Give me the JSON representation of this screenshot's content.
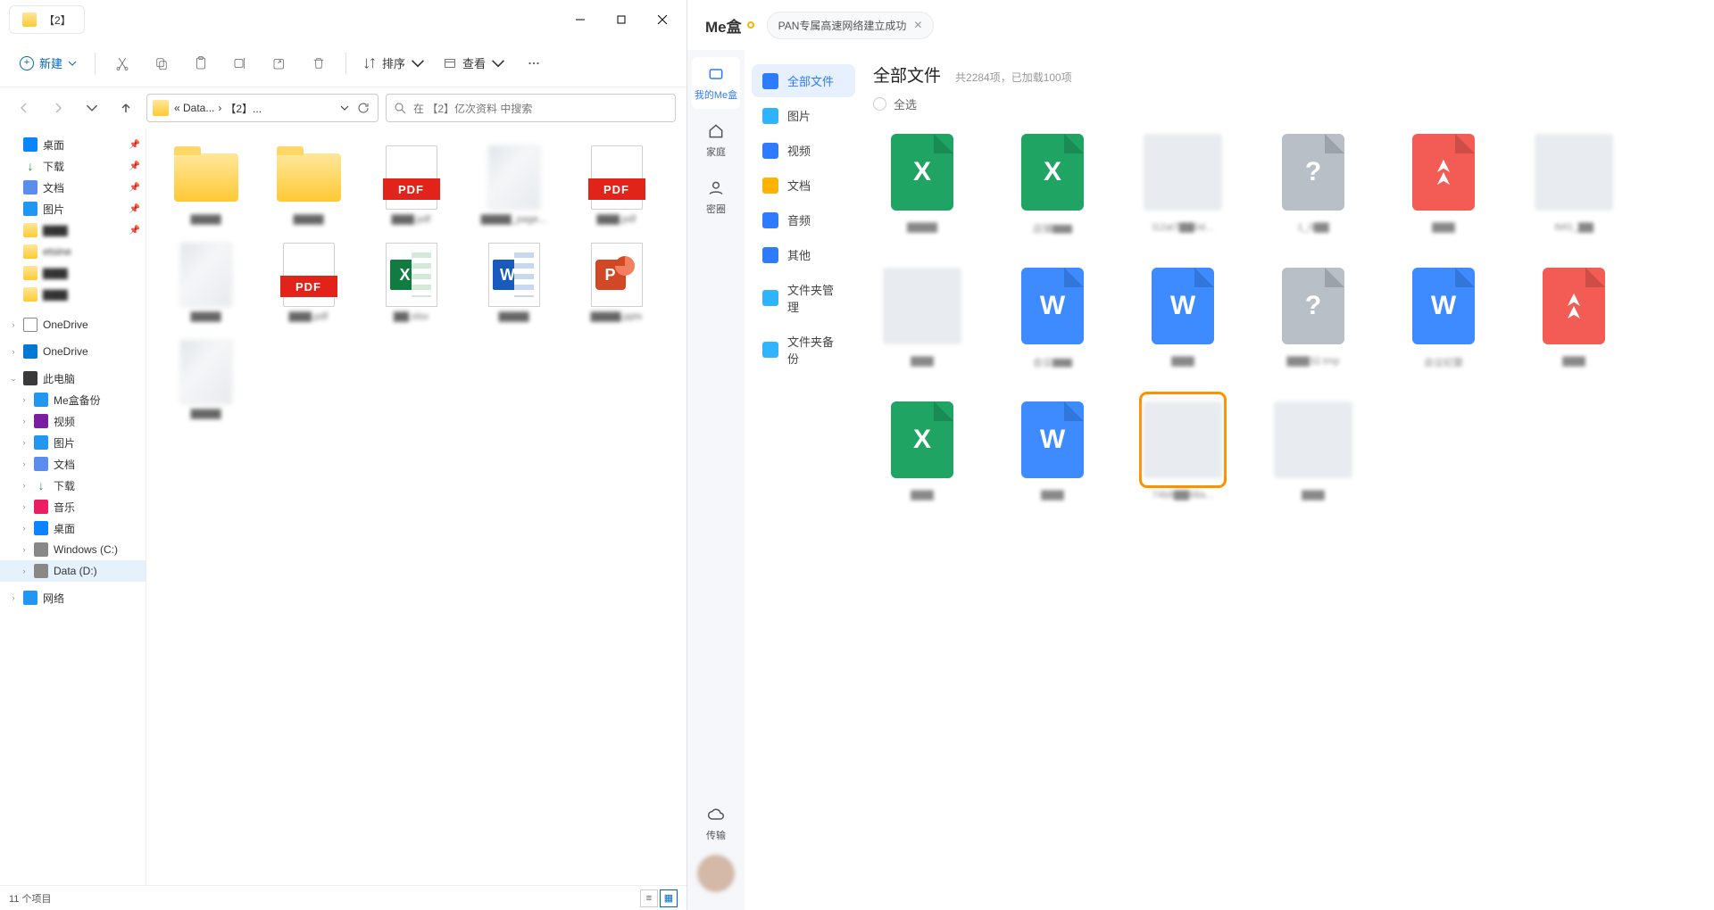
{
  "explorer": {
    "tab_title": "【2】",
    "toolbar": {
      "new": "新建",
      "sort": "排序",
      "view": "查看"
    },
    "breadcrumb": {
      "seg1": "« Data...",
      "seg2": "【2】..."
    },
    "search_placeholder": "在 【2】亿次资料 中搜索",
    "nav": {
      "desktop": "桌面",
      "downloads": "下载",
      "documents": "文档",
      "pictures": "图片",
      "folder_blur1": "▇▇▇",
      "folder_blur2": "etsine",
      "folder_blur3": "▇▇▇",
      "folder_blur4": "▇▇▇",
      "onedrive1": "OneDrive",
      "onedrive2": "OneDrive",
      "thispc": "此电脑",
      "mebox": "Me盒备份",
      "video": "视频",
      "pictures2": "图片",
      "documents2": "文档",
      "downloads2": "下载",
      "music": "音乐",
      "desktop2": "桌面",
      "drive_c": "Windows (C:)",
      "drive_d": "Data (D:)",
      "network": "网络"
    },
    "files": [
      {
        "kind": "folder",
        "name": "▇▇▇▇"
      },
      {
        "kind": "folder",
        "name": "▇▇▇▇"
      },
      {
        "kind": "pdf",
        "name": "▇▇▇.pdf"
      },
      {
        "kind": "image",
        "name": "▇▇▇▇_page..."
      },
      {
        "kind": "pdf",
        "name": "▇▇▇.pdf"
      },
      {
        "kind": "image",
        "name": "▇▇▇▇"
      },
      {
        "kind": "pdf",
        "name": "▇▇▇.pdf"
      },
      {
        "kind": "excel",
        "name": "▇▇.xlsx"
      },
      {
        "kind": "word",
        "name": "▇▇▇▇"
      },
      {
        "kind": "ppt",
        "name": "▇▇▇▇.pptx"
      },
      {
        "kind": "image",
        "name": "▇▇▇▇"
      }
    ],
    "status": "11 个项目"
  },
  "cloud": {
    "brand": "Me盒",
    "header_tab": "PAN专属高速网络建立成功",
    "rail": {
      "mybox": "我的Me盒",
      "family": "家庭",
      "circle": "密圈",
      "transfer": "传输"
    },
    "cats": {
      "all": "全部文件",
      "pic": "图片",
      "vid": "视频",
      "doc": "文档",
      "aud": "音频",
      "oth": "其他",
      "fm": "文件夹管理",
      "fb": "文件夹备份"
    },
    "main_title": "全部文件",
    "main_sub": "共2284项，已加载100项",
    "select_all": "全选",
    "files": [
      {
        "t": "x",
        "n": "▇▇▇▇"
      },
      {
        "t": "x",
        "n": "店铺▇▇"
      },
      {
        "t": "img",
        "n": "l12at7▇▇0d..."
      },
      {
        "t": "q",
        "n": "1_0▇▇"
      },
      {
        "t": "pdf",
        "n": "▇▇▇"
      },
      {
        "t": "img",
        "n": "IMG_▇▇"
      },
      {
        "t": "img",
        "n": "▇▇▇"
      },
      {
        "t": "w",
        "n": "会议▇▇"
      },
      {
        "t": "w",
        "n": "▇▇▇"
      },
      {
        "t": "q",
        "n": "▇▇▇32.tmp"
      },
      {
        "t": "w",
        "n": "会议纪要"
      },
      {
        "t": "pdf",
        "n": "▇▇▇"
      },
      {
        "t": "x",
        "n": "▇▇▇"
      },
      {
        "t": "w",
        "n": "▇▇▇"
      },
      {
        "t": "img",
        "n": "74b8▇▇68a...",
        "sel": true
      },
      {
        "t": "img",
        "n": "▇▇▇"
      }
    ]
  }
}
